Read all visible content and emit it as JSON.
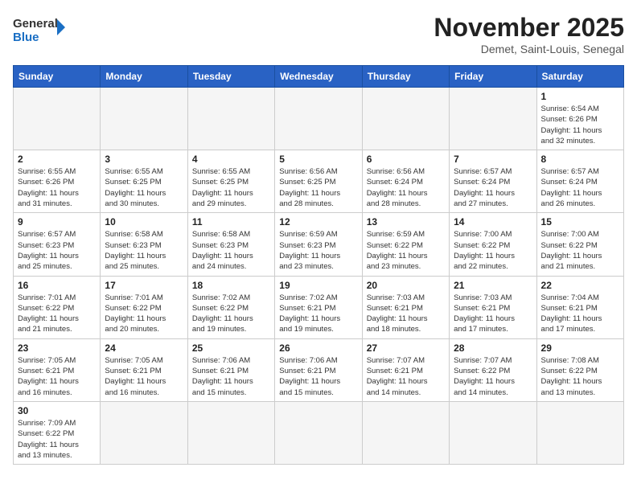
{
  "header": {
    "logo_general": "General",
    "logo_blue": "Blue",
    "month_title": "November 2025",
    "location": "Demet, Saint-Louis, Senegal"
  },
  "weekdays": [
    "Sunday",
    "Monday",
    "Tuesday",
    "Wednesday",
    "Thursday",
    "Friday",
    "Saturday"
  ],
  "weeks": [
    [
      {
        "day": "",
        "info": ""
      },
      {
        "day": "",
        "info": ""
      },
      {
        "day": "",
        "info": ""
      },
      {
        "day": "",
        "info": ""
      },
      {
        "day": "",
        "info": ""
      },
      {
        "day": "",
        "info": ""
      },
      {
        "day": "1",
        "info": "Sunrise: 6:54 AM\nSunset: 6:26 PM\nDaylight: 11 hours\nand 32 minutes."
      }
    ],
    [
      {
        "day": "2",
        "info": "Sunrise: 6:55 AM\nSunset: 6:26 PM\nDaylight: 11 hours\nand 31 minutes."
      },
      {
        "day": "3",
        "info": "Sunrise: 6:55 AM\nSunset: 6:25 PM\nDaylight: 11 hours\nand 30 minutes."
      },
      {
        "day": "4",
        "info": "Sunrise: 6:55 AM\nSunset: 6:25 PM\nDaylight: 11 hours\nand 29 minutes."
      },
      {
        "day": "5",
        "info": "Sunrise: 6:56 AM\nSunset: 6:25 PM\nDaylight: 11 hours\nand 28 minutes."
      },
      {
        "day": "6",
        "info": "Sunrise: 6:56 AM\nSunset: 6:24 PM\nDaylight: 11 hours\nand 28 minutes."
      },
      {
        "day": "7",
        "info": "Sunrise: 6:57 AM\nSunset: 6:24 PM\nDaylight: 11 hours\nand 27 minutes."
      },
      {
        "day": "8",
        "info": "Sunrise: 6:57 AM\nSunset: 6:24 PM\nDaylight: 11 hours\nand 26 minutes."
      }
    ],
    [
      {
        "day": "9",
        "info": "Sunrise: 6:57 AM\nSunset: 6:23 PM\nDaylight: 11 hours\nand 25 minutes."
      },
      {
        "day": "10",
        "info": "Sunrise: 6:58 AM\nSunset: 6:23 PM\nDaylight: 11 hours\nand 25 minutes."
      },
      {
        "day": "11",
        "info": "Sunrise: 6:58 AM\nSunset: 6:23 PM\nDaylight: 11 hours\nand 24 minutes."
      },
      {
        "day": "12",
        "info": "Sunrise: 6:59 AM\nSunset: 6:23 PM\nDaylight: 11 hours\nand 23 minutes."
      },
      {
        "day": "13",
        "info": "Sunrise: 6:59 AM\nSunset: 6:22 PM\nDaylight: 11 hours\nand 23 minutes."
      },
      {
        "day": "14",
        "info": "Sunrise: 7:00 AM\nSunset: 6:22 PM\nDaylight: 11 hours\nand 22 minutes."
      },
      {
        "day": "15",
        "info": "Sunrise: 7:00 AM\nSunset: 6:22 PM\nDaylight: 11 hours\nand 21 minutes."
      }
    ],
    [
      {
        "day": "16",
        "info": "Sunrise: 7:01 AM\nSunset: 6:22 PM\nDaylight: 11 hours\nand 21 minutes."
      },
      {
        "day": "17",
        "info": "Sunrise: 7:01 AM\nSunset: 6:22 PM\nDaylight: 11 hours\nand 20 minutes."
      },
      {
        "day": "18",
        "info": "Sunrise: 7:02 AM\nSunset: 6:22 PM\nDaylight: 11 hours\nand 19 minutes."
      },
      {
        "day": "19",
        "info": "Sunrise: 7:02 AM\nSunset: 6:21 PM\nDaylight: 11 hours\nand 19 minutes."
      },
      {
        "day": "20",
        "info": "Sunrise: 7:03 AM\nSunset: 6:21 PM\nDaylight: 11 hours\nand 18 minutes."
      },
      {
        "day": "21",
        "info": "Sunrise: 7:03 AM\nSunset: 6:21 PM\nDaylight: 11 hours\nand 17 minutes."
      },
      {
        "day": "22",
        "info": "Sunrise: 7:04 AM\nSunset: 6:21 PM\nDaylight: 11 hours\nand 17 minutes."
      }
    ],
    [
      {
        "day": "23",
        "info": "Sunrise: 7:05 AM\nSunset: 6:21 PM\nDaylight: 11 hours\nand 16 minutes."
      },
      {
        "day": "24",
        "info": "Sunrise: 7:05 AM\nSunset: 6:21 PM\nDaylight: 11 hours\nand 16 minutes."
      },
      {
        "day": "25",
        "info": "Sunrise: 7:06 AM\nSunset: 6:21 PM\nDaylight: 11 hours\nand 15 minutes."
      },
      {
        "day": "26",
        "info": "Sunrise: 7:06 AM\nSunset: 6:21 PM\nDaylight: 11 hours\nand 15 minutes."
      },
      {
        "day": "27",
        "info": "Sunrise: 7:07 AM\nSunset: 6:21 PM\nDaylight: 11 hours\nand 14 minutes."
      },
      {
        "day": "28",
        "info": "Sunrise: 7:07 AM\nSunset: 6:22 PM\nDaylight: 11 hours\nand 14 minutes."
      },
      {
        "day": "29",
        "info": "Sunrise: 7:08 AM\nSunset: 6:22 PM\nDaylight: 11 hours\nand 13 minutes."
      }
    ],
    [
      {
        "day": "30",
        "info": "Sunrise: 7:09 AM\nSunset: 6:22 PM\nDaylight: 11 hours\nand 13 minutes."
      },
      {
        "day": "",
        "info": ""
      },
      {
        "day": "",
        "info": ""
      },
      {
        "day": "",
        "info": ""
      },
      {
        "day": "",
        "info": ""
      },
      {
        "day": "",
        "info": ""
      },
      {
        "day": "",
        "info": ""
      }
    ]
  ]
}
